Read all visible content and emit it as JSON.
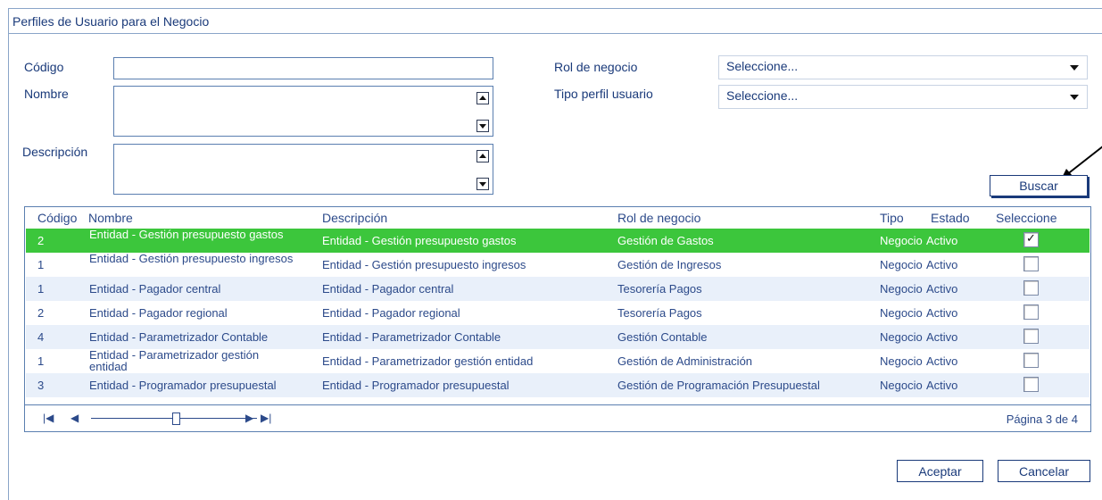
{
  "title": "Perfiles de Usuario para el Negocio",
  "form": {
    "codigo_label": "Código",
    "codigo_value": "",
    "nombre_label": "Nombre",
    "nombre_value": "",
    "descripcion_label": "Descripción",
    "descripcion_value": "",
    "rol_label": "Rol de negocio",
    "rol_value": "Seleccione...",
    "tipo_label": "Tipo perfil usuario",
    "tipo_value": "Seleccione..."
  },
  "buttons": {
    "search": "Buscar",
    "accept": "Aceptar",
    "cancel": "Cancelar"
  },
  "table": {
    "headers": {
      "codigo": "Código",
      "nombre": "Nombre",
      "descripcion": "Descripción",
      "rol": "Rol de negocio",
      "tipo": "Tipo",
      "estado": "Estado",
      "seleccione": "Seleccione"
    },
    "rows": [
      {
        "codigo": "2",
        "nombre": "Entidad - Gestión presupuesto gastos",
        "descripcion": "Entidad - Gestión presupuesto gastos",
        "rol": "Gestión de Gastos",
        "tipo": "Negocio",
        "estado": "Activo",
        "selected": true
      },
      {
        "codigo": "1",
        "nombre": "Entidad - Gestión presupuesto ingresos",
        "descripcion": "Entidad - Gestión presupuesto ingresos",
        "rol": "Gestión de Ingresos",
        "tipo": "Negocio",
        "estado": "Activo",
        "selected": false
      },
      {
        "codigo": "1",
        "nombre": "Entidad - Pagador central",
        "descripcion": "Entidad - Pagador central",
        "rol": "Tesorería Pagos",
        "tipo": "Negocio",
        "estado": "Activo",
        "selected": false
      },
      {
        "codigo": "2",
        "nombre": "Entidad - Pagador regional",
        "descripcion": "Entidad - Pagador regional",
        "rol": "Tesorería Pagos",
        "tipo": "Negocio",
        "estado": "Activo",
        "selected": false
      },
      {
        "codigo": "4",
        "nombre": "Entidad - Parametrizador Contable",
        "descripcion": "Entidad - Parametrizador Contable",
        "rol": "Gestión Contable",
        "tipo": "Negocio",
        "estado": "Activo",
        "selected": false
      },
      {
        "codigo": "1",
        "nombre": "Entidad - Parametrizador gestión entidad",
        "descripcion": "Entidad - Parametrizador gestión entidad",
        "rol": "Gestión de Administración",
        "tipo": "Negocio",
        "estado": "Activo",
        "selected": false
      },
      {
        "codigo": "3",
        "nombre": "Entidad - Programador presupuestal",
        "descripcion": "Entidad - Programador presupuestal",
        "rol": "Gestión de Programación Presupuestal",
        "tipo": "Negocio",
        "estado": "Activo",
        "selected": false
      }
    ]
  },
  "pager": {
    "page_text": "Página 3 de 4",
    "icons": [
      "first-page-icon",
      "prev-page-icon",
      "next-page-icon",
      "last-page-icon"
    ]
  },
  "colors": {
    "selected_row": "#3cc63c",
    "text": "#1a3a7a",
    "border": "#5b7fb0"
  }
}
